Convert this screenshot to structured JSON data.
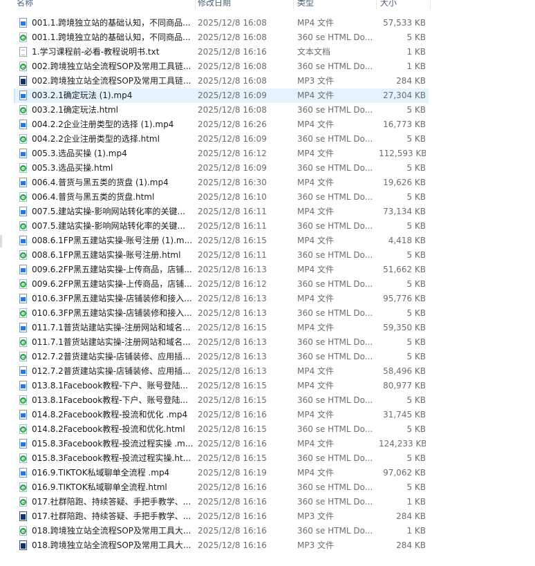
{
  "header": {
    "name": "名称",
    "date": "修改日期",
    "type": "类型",
    "size": "大小"
  },
  "files": [
    {
      "icon": "mp4",
      "name": "001.1.跨境独立站的基础认知，不同商品...",
      "date": "2025/12/8 16:08",
      "type": "MP4 文件",
      "size": "57,533 KB"
    },
    {
      "icon": "html",
      "name": "001.1.跨境独立站的基础认知，不同商品...",
      "date": "2025/12/8 16:08",
      "type": "360 se HTML Do...",
      "size": "5 KB"
    },
    {
      "icon": "txt",
      "name": "1.学习课程前-必看-教程说明书.txt",
      "date": "2025/12/8 16:16",
      "type": "文本文档",
      "size": "1 KB"
    },
    {
      "icon": "html",
      "name": "002.跨境独立站全流程SOP及常用工具链...",
      "date": "2025/12/8 16:08",
      "type": "360 se HTML Do...",
      "size": "1 KB"
    },
    {
      "icon": "mp3",
      "name": "002.跨境独立站全流程SOP及常用工具链...",
      "date": "2025/12/8 16:08",
      "type": "MP3 文件",
      "size": "284 KB"
    },
    {
      "icon": "mp4",
      "name": "003.2.1确定玩法 (1).mp4",
      "date": "2025/12/8 16:09",
      "type": "MP4 文件",
      "size": "27,304 KB",
      "selected": true
    },
    {
      "icon": "html",
      "name": "003.2.1确定玩法.html",
      "date": "2025/12/8 16:08",
      "type": "360 se HTML Do...",
      "size": "5 KB"
    },
    {
      "icon": "mp4",
      "name": "004.2.2企业注册类型的选择 (1).mp4",
      "date": "2025/12/8 16:26",
      "type": "MP4 文件",
      "size": "16,773 KB"
    },
    {
      "icon": "html",
      "name": "004.2.2企业注册类型的选择.html",
      "date": "2025/12/8 16:09",
      "type": "360 se HTML Do...",
      "size": "5 KB"
    },
    {
      "icon": "mp4",
      "name": "005.3.选品买操 (1).mp4",
      "date": "2025/12/8 16:12",
      "type": "MP4 文件",
      "size": "112,593 KB"
    },
    {
      "icon": "html",
      "name": "005.3.选品买操.html",
      "date": "2025/12/8 16:09",
      "type": "360 se HTML Do...",
      "size": "5 KB"
    },
    {
      "icon": "mp4",
      "name": "006.4.普货与黑五类的货盘 (1).mp4",
      "date": "2025/12/8 16:30",
      "type": "MP4 文件",
      "size": "19,626 KB"
    },
    {
      "icon": "html",
      "name": "006.4.普货与黑五类的货盘.html",
      "date": "2025/12/8 16:10",
      "type": "360 se HTML Do...",
      "size": "5 KB"
    },
    {
      "icon": "mp4",
      "name": "007.5.建站实操-影响网站转化率的关键...",
      "date": "2025/12/8 16:11",
      "type": "MP4 文件",
      "size": "73,134 KB"
    },
    {
      "icon": "html",
      "name": "007.5.建站实操-影响网站转化率的关键...",
      "date": "2025/12/8 16:11",
      "type": "360 se HTML Do...",
      "size": "5 KB"
    },
    {
      "icon": "mp4",
      "name": "008.6.1FP黑五建站实操-账号注册 (1).m...",
      "date": "2025/12/8 16:15",
      "type": "MP4 文件",
      "size": "4,418 KB"
    },
    {
      "icon": "html",
      "name": "008.6.1FP黑五建站实操-账号注册.html",
      "date": "2025/12/8 16:11",
      "type": "360 se HTML Do...",
      "size": "5 KB"
    },
    {
      "icon": "mp4",
      "name": "009.6.2FP黑五建站实操-上传商品，店铺...",
      "date": "2025/12/8 16:13",
      "type": "MP4 文件",
      "size": "51,662 KB"
    },
    {
      "icon": "html",
      "name": "009.6.2FP黑五建站实操-上传商品，店铺...",
      "date": "2025/12/8 16:12",
      "type": "360 se HTML Do...",
      "size": "5 KB"
    },
    {
      "icon": "mp4",
      "name": "010.6.3FP黑五建站实操-店铺装修和接入...",
      "date": "2025/12/8 16:13",
      "type": "MP4 文件",
      "size": "95,776 KB"
    },
    {
      "icon": "html",
      "name": "010.6.3FP黑五建站实操-店铺装修和接入...",
      "date": "2025/12/8 16:13",
      "type": "360 se HTML Do...",
      "size": "5 KB"
    },
    {
      "icon": "mp4",
      "name": "011.7.1普货站建站实操-注册网站和域名...",
      "date": "2025/12/8 16:15",
      "type": "MP4 文件",
      "size": "59,350 KB"
    },
    {
      "icon": "html",
      "name": "011.7.1普货站建站实操-注册网站和域名...",
      "date": "2025/12/8 16:13",
      "type": "360 se HTML Do...",
      "size": "5 KB"
    },
    {
      "icon": "html",
      "name": "012.7.2普货建站实操-店铺装修、应用插...",
      "date": "2025/12/8 16:13",
      "type": "360 se HTML Do...",
      "size": "5 KB"
    },
    {
      "icon": "mp4",
      "name": "012.7.2普货建站实操-店铺装修、应用插...",
      "date": "2025/12/8 16:13",
      "type": "MP4 文件",
      "size": "58,496 KB"
    },
    {
      "icon": "mp4",
      "name": "013.8.1Facebook教程-下户、账号登陆...",
      "date": "2025/12/8 16:15",
      "type": "MP4 文件",
      "size": "80,977 KB"
    },
    {
      "icon": "html",
      "name": "013.8.1Facebook教程-下户、账号登陆...",
      "date": "2025/12/8 16:15",
      "type": "360 se HTML Do...",
      "size": "5 KB"
    },
    {
      "icon": "mp4",
      "name": "014.8.2Facebook教程-投流和优化 .mp4",
      "date": "2025/12/8 16:16",
      "type": "MP4 文件",
      "size": "31,745 KB"
    },
    {
      "icon": "html",
      "name": "014.8.2Facebook教程-投流和优化.html",
      "date": "2025/12/8 16:15",
      "type": "360 se HTML Do...",
      "size": "5 KB"
    },
    {
      "icon": "mp4",
      "name": "015.8.3Facebook教程-投流过程实操 .m...",
      "date": "2025/12/8 16:16",
      "type": "MP4 文件",
      "size": "124,233 KB"
    },
    {
      "icon": "html",
      "name": "015.8.3Facebook教程-投流过程实操.ht...",
      "date": "2025/12/8 16:15",
      "type": "360 se HTML Do...",
      "size": "5 KB"
    },
    {
      "icon": "mp4",
      "name": "016.9.TIKTOK私域聊单全流程 .mp4",
      "date": "2025/12/8 16:19",
      "type": "MP4 文件",
      "size": "97,062 KB"
    },
    {
      "icon": "html",
      "name": "016.9.TIKTOK私域聊单全流程.html",
      "date": "2025/12/8 16:16",
      "type": "360 se HTML Do...",
      "size": "5 KB"
    },
    {
      "icon": "html",
      "name": "017.社群陪跑、持续答疑、手把手教学、...",
      "date": "2025/12/8 16:16",
      "type": "360 se HTML Do...",
      "size": "1 KB"
    },
    {
      "icon": "mp3",
      "name": "017.社群陪跑、持续答疑、手把手教学、...",
      "date": "2025/12/8 16:16",
      "type": "MP3 文件",
      "size": "284 KB"
    },
    {
      "icon": "html",
      "name": "018.跨境独立站全流程SOP及常用工具大...",
      "date": "2025/12/8 16:16",
      "type": "360 se HTML Do...",
      "size": "1 KB"
    },
    {
      "icon": "mp3",
      "name": "018.跨境独立站全流程SOP及常用工具大...",
      "date": "2025/12/8 16:16",
      "type": "MP3 文件",
      "size": "284 KB"
    }
  ]
}
